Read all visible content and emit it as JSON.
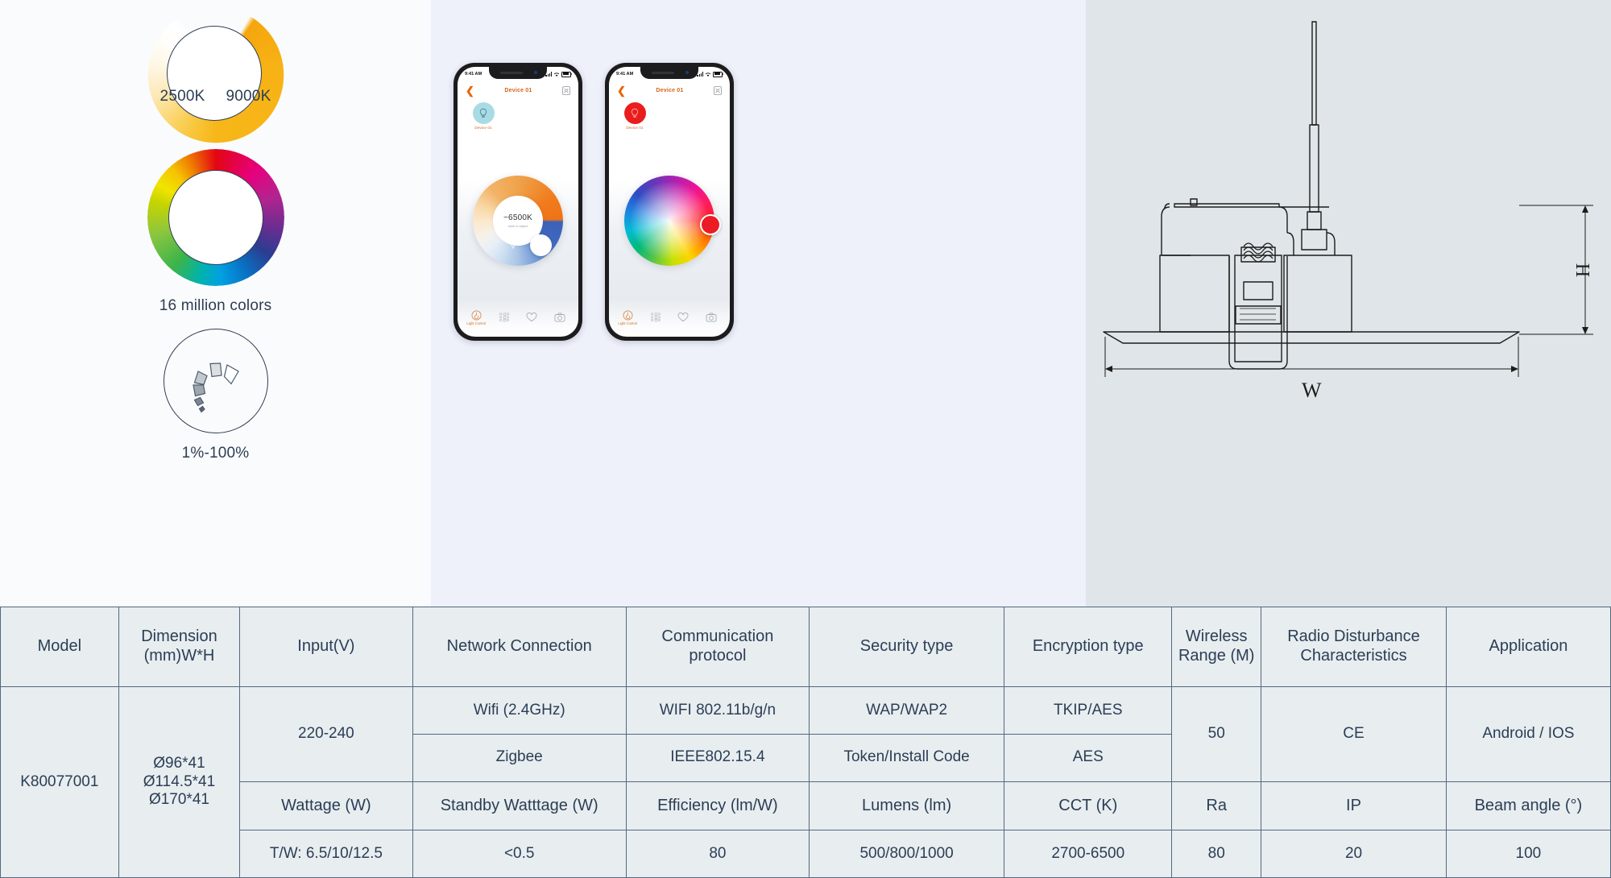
{
  "features": {
    "cct": {
      "name": "color-temperature-ring",
      "label_low": "2500K",
      "label_high": "9000K"
    },
    "rgb": {
      "name": "rgb-color-ring",
      "label": "16 million colors"
    },
    "dimming": {
      "name": "dimming-ring",
      "label": "1%-100%"
    }
  },
  "phones": [
    {
      "id": "phone-cct",
      "status_time": "9:41 AM",
      "app_title": "Device 01",
      "device_chip_label": "Device 01",
      "wheel_value": "~6500K",
      "wheel_sub": "slide to adjust",
      "tabs": [
        {
          "icon": "light-control-icon",
          "label": "Light Control"
        },
        {
          "icon": "scene-grid-icon",
          "label": ""
        },
        {
          "icon": "heart-icon",
          "label": ""
        },
        {
          "icon": "camera-icon",
          "label": ""
        }
      ]
    },
    {
      "id": "phone-rgb",
      "status_time": "9:41 AM",
      "app_title": "Device 01",
      "device_chip_label": "Device 01",
      "tabs": [
        {
          "icon": "light-control-icon",
          "label": "Light Control"
        },
        {
          "icon": "scene-grid-icon",
          "label": ""
        },
        {
          "icon": "heart-icon",
          "label": ""
        },
        {
          "icon": "camera-icon",
          "label": ""
        }
      ]
    }
  ],
  "drawing": {
    "height_label": "H",
    "width_label": "W"
  },
  "table": {
    "headers": [
      "Model",
      "Dimension (mm)W*H",
      "Input(V)",
      "Network Connection",
      "Communication protocol",
      "Security type",
      "Encryption type",
      "Wireless Range (M)",
      "Radio Disturbance Characteristics",
      "Application"
    ],
    "headers_line": {
      "model": "Model",
      "dimension_l1": "Dimension",
      "dimension_l2": "(mm)W*H",
      "input": "Input(V)",
      "network": "Network Connection",
      "protocol_l1": "Communication",
      "protocol_l2": "protocol",
      "security": "Security type",
      "encryption": "Encryption type",
      "wireless_l1": "Wireless",
      "wireless_l2": "Range (M)",
      "radio_l1": "Radio Disturbance",
      "radio_l2": "Characteristics",
      "application": "Application"
    },
    "model": "K80077001",
    "dimension_values": [
      "Ø96*41",
      "Ø114.5*41",
      "Ø170*41"
    ],
    "input": "220-240",
    "network_rows": [
      {
        "network": "Wifi (2.4GHz)",
        "protocol": "WIFI 802.11b/g/n",
        "security": "WAP/WAP2",
        "encryption": "TKIP/AES"
      },
      {
        "network": "Zigbee",
        "protocol": "IEEE802.15.4",
        "security": "Token/Install Code",
        "encryption": "AES"
      }
    ],
    "wireless_range": "50",
    "radio_disturbance": "CE",
    "application": "Android / IOS",
    "sub_headers": [
      "Wattage (W)",
      "Standby Watttage (W)",
      "Efficiency (lm/W)",
      "Lumens (lm)",
      "CCT (K)",
      "Ra",
      "IP",
      "Beam angle (°)"
    ],
    "sub_values": [
      "T/W: 6.5/10/12.5",
      "<0.5",
      "80",
      "500/800/1000",
      "2700-6500",
      "80",
      "20",
      "100"
    ]
  },
  "colors": {
    "panel_a_bg": "#fafbfd",
    "panel_b_bg": "#eef1fa",
    "panel_c_bg": "#dfe5e8",
    "table_bg": "#e8edf0",
    "table_border": "#53687f",
    "text": "#2b3e55",
    "accent_orange": "#d4641a",
    "cct_warm": "#f5a60d",
    "rgb_red": "#ea1c1c"
  }
}
